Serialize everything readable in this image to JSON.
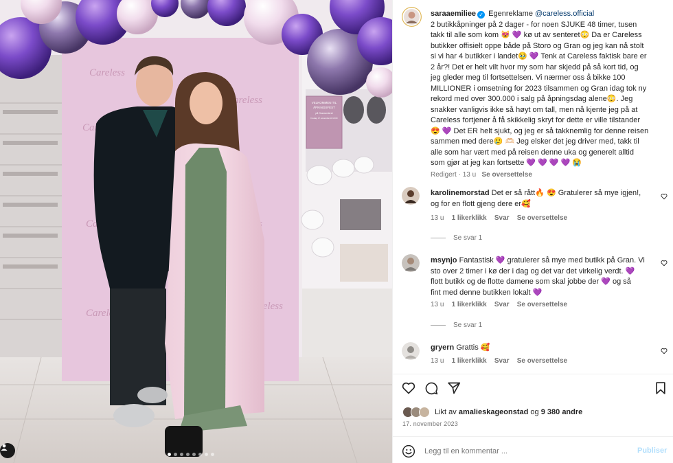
{
  "post": {
    "username": "saraaemiliee",
    "verified_mark": "✓",
    "ad_label": "Egenreklame",
    "partner": "@careless.official",
    "caption_lines": [
      "2 butikkåpninger på 2 dager - for noen SJUKE 48 timer, tusen",
      "takk til alle som kom 😻 💜  kø ut av senteret😳  Da er Careless",
      "butikker offisielt oppe både på Storo og Gran og jeg kan nå stolt",
      "si vi har 4 butikker i landet🥹 💜  Tenk at Careless faktisk bare er",
      "2 år?! Det er helt vilt hvor my som har skjedd på så kort tid, og",
      "jeg gleder meg til fortsettelsen. Vi nærmer oss å bikke 100",
      "MILLIONER i omsetning for 2023 tilsammen og Gran idag tok ny",
      "rekord med over 300.000 i salg på åpningsdag alene😳. Jeg",
      "snakker vanligvis ikke så høyt om tall, men nå kjente jeg på at",
      "Careless fortjener å få skikkelig skryt for dette er ville tilstander",
      "😍 💜  Det ER helt sjukt, og jeg er så takknemlig for denne reisen",
      "sammen med dere🥲 🫶🏻  Jeg elsker det jeg driver med, takk til",
      "alle som har vært med på reisen denne uka og generelt alltid",
      "som gjør at jeg kan fortsette 💜 💜 💜 💜 😭"
    ],
    "meta_edited": "Redigert",
    "meta_time": "13 u",
    "meta_translate": "Se oversettelse"
  },
  "comments": [
    {
      "username": "karolinemorstad",
      "lines": [
        "Det er så rått🔥 😍  Gratulerer så mye igjen!,",
        "og for en flott gjeng dere er🥰"
      ],
      "time": "13 u",
      "likes": "1 likerklikk",
      "reply": "Svar",
      "translate": "Se oversettelse",
      "view_replies": "Se svar 1"
    },
    {
      "username": "msynjo",
      "lines": [
        "Fantastisk 💜  gratulerer så mye med butikk på Gran. Vi",
        "sto over 2 timer i kø der i dag og det var det virkelig verdt. 💜",
        "flott butikk og de flotte damene som skal jobbe der 💜 og så",
        "fint med denne butikken lokalt 💜"
      ],
      "time": "13 u",
      "likes": "1 likerklikk",
      "reply": "Svar",
      "translate": "Se oversettelse",
      "view_replies": "Se svar 1"
    },
    {
      "username": "gryern",
      "lines": [
        "Grattis 🥰"
      ],
      "time": "13 u",
      "likes": "1 likerklikk",
      "reply": "Svar",
      "translate": "Se oversettelse"
    }
  ],
  "likes": {
    "prefix": "Likt av",
    "user": "amalieskageonstad",
    "joiner": "og",
    "others": "9 380 andre"
  },
  "date": "17. november 2023",
  "comment_box": {
    "placeholder": "Legg til en kommentar ...",
    "publish": "Publiser"
  },
  "photo": {
    "banner_line1": "VELKOMMEN TIL",
    "banner_line2": "ÅPNINGSFEST",
    "banner_line3": "på Gransenteret",
    "banner_line4": "Fredag 17.november kl 10:00",
    "brand": "Careless"
  },
  "icons": {
    "like": "heart-icon",
    "comment": "comment-icon",
    "share": "paper-plane-icon",
    "save": "bookmark-icon",
    "emoji": "smiley-icon",
    "tag": "user-tag-icon"
  },
  "colors": {
    "link": "#00376b",
    "verified": "#0095f6",
    "muted": "#737373",
    "publish_disabled": "#b2dffc",
    "balloon_purple": "#7b4bc9",
    "backdrop_pink": "#e7c6dd"
  }
}
